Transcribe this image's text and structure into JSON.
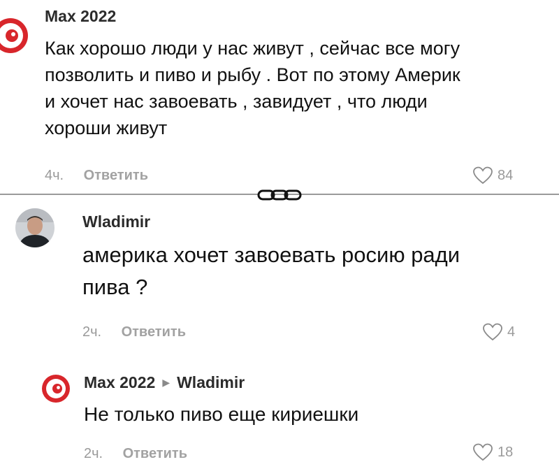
{
  "comments": [
    {
      "author": "Max 2022",
      "text": "Как хорошо люди у нас живут , сейчас все могу позволить и пиво и рыбу . Вот по этому Америк и хочет нас завоевать , завидует , что люди хороши живут",
      "lines": [
        "Как хорошо люди у нас живут , сейчас все могу",
        "позволить и пиво и рыбу . Вот по этому Америк",
        "и хочет нас завоевать , завидует , что люди",
        "хороши живут"
      ],
      "time": "4ч.",
      "reply_label": "Ответить",
      "likes": "84",
      "avatar_icon": "red-eye-avatar-icon"
    },
    {
      "author": "Wladimir",
      "lines": [
        "америка хочет завоевать росию ради",
        "пива ?"
      ],
      "time": "2ч.",
      "reply_label": "Ответить",
      "likes": "4",
      "avatar_icon": "user-photo-avatar"
    },
    {
      "author": "Max 2022",
      "reply_to": "Wladimir",
      "lines": [
        "Не только пиво еще кириешки"
      ],
      "time": "2ч.",
      "reply_label": "Ответить",
      "likes": "18",
      "avatar_icon": "red-eye-avatar-icon"
    }
  ],
  "colors": {
    "background": "#ffffff",
    "text": "#111111",
    "muted": "#9a9a9a",
    "avatar_red": "#d8262b"
  }
}
